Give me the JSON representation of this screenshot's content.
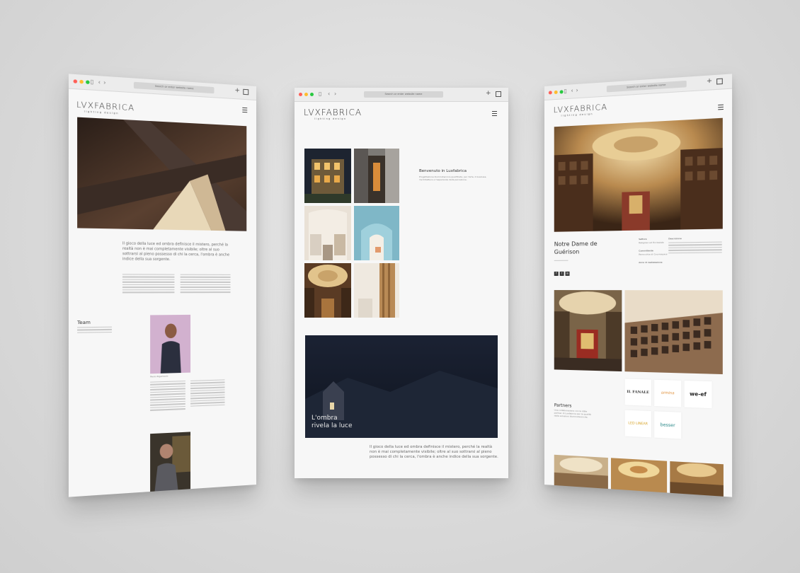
{
  "brand": {
    "logo": "LVXFABRICA",
    "tagline": "lighting design"
  },
  "browser": {
    "url": "Search or enter website name"
  },
  "colors": {
    "dot_red": "#ff5f57",
    "dot_yellow": "#febc2e",
    "dot_green": "#28c840"
  },
  "left": {
    "intro": "Il gioco della luce ed ombra definisce il mistero, perché la realtà non è mai completamente visibile; oltre al suo sottrarsi al pieno possesso di chi la cerca, l'ombra è anche indice della sua sorgente.",
    "team_title": "Team",
    "member_caption": "Paolo Rigamonti"
  },
  "mid": {
    "welcome_title": "Benvenuto in Luxfabrica",
    "welcome_text": "Progettazione illuminotecnica qualificata, per l'arte, il business, l'architettura e l'esperienza della percezione.",
    "banner_line1": "L'ombra",
    "banner_line2": "rivela la luce",
    "bottom_text": "Il gioco della luce ed ombra definisce il mistero, perché la realtà non è mai completamente visibile; oltre al suo sottrarsi al pieno possesso di chi la cerca, l'ombra è anche indice della sua sorgente."
  },
  "right": {
    "back_label": "Back",
    "project_title_line1": "Notre Dame de",
    "project_title_line2": "Guérison",
    "meta_col1_label": "Settore",
    "meta_col1_value": "Religioso ed Ecclesiale",
    "meta_col1b_label": "Committente",
    "meta_col1b_value": "Parrocchia di Courmayeur",
    "meta_col1c_label": "Anno di realizzazione",
    "meta_col2_label": "Descrizione",
    "partners_title": "Partners",
    "partners_text": "Una collaborazione con le ditte partner di Luxfabrica per la qualità delle soluzioni illuminotecniche.",
    "partner_logos": [
      "IL FANALE",
      "ormina",
      "we-ef",
      "LED LINEAR",
      "besser"
    ]
  }
}
